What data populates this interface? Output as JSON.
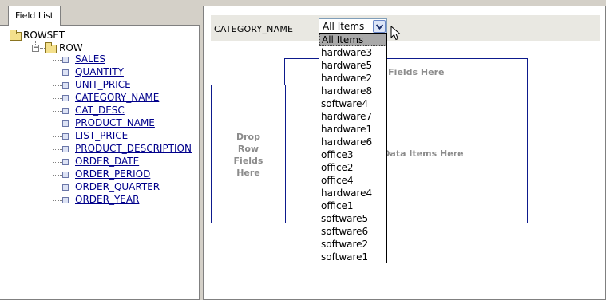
{
  "left_tab": {
    "label": "Field List"
  },
  "tree": {
    "root": {
      "label": "ROWSET"
    },
    "row": {
      "label": "ROW",
      "expander": "−"
    },
    "fields": [
      "SALES",
      "QUANTITY",
      "UNIT_PRICE",
      "CATEGORY_NAME",
      "CAT_DESC",
      "PRODUCT_NAME",
      "LIST_PRICE",
      "PRODUCT_DESCRIPTION",
      "ORDER_DATE",
      "ORDER_PERIOD",
      "ORDER_QUARTER",
      "ORDER_YEAR"
    ]
  },
  "page_field": {
    "label": "CATEGORY_NAME",
    "selected": "All Items"
  },
  "dropdown": {
    "options": [
      "All Items",
      "hardware3",
      "hardware5",
      "hardware2",
      "hardware8",
      "software4",
      "hardware7",
      "hardware1",
      "hardware6",
      "office3",
      "office2",
      "office4",
      "hardware4",
      "office1",
      "software5",
      "software6",
      "software2",
      "software1"
    ],
    "selected_index": 0
  },
  "zones": {
    "column": "Drop Column Fields Here",
    "row": "Drop Row Fields Here",
    "data": "Drop Data Items Here"
  },
  "colors": {
    "panel_bg": "#d4d0c8",
    "link": "#00008b",
    "zone_border": "#0d1a8c",
    "zone_text": "#8c8c8c"
  }
}
